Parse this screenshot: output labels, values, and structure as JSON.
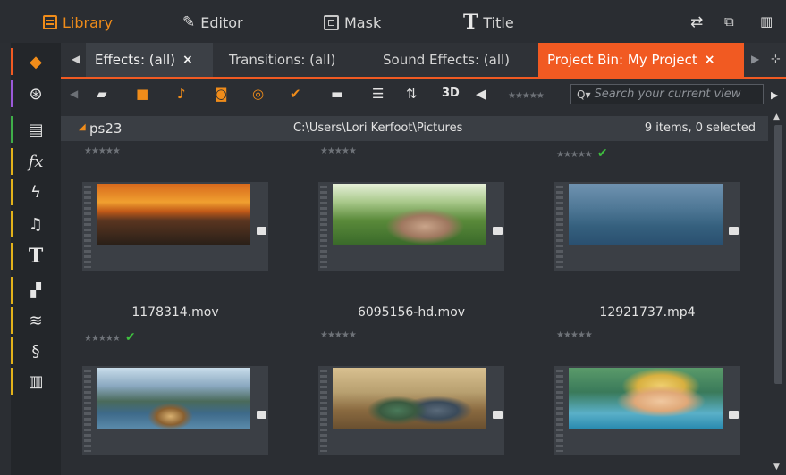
{
  "menu": {
    "library": "Library",
    "editor": "Editor",
    "mask": "Mask",
    "title": "Title",
    "title_glyph": "T",
    "editor_glyph": "✎"
  },
  "tabs": [
    {
      "label": "Effects: (all)",
      "close": "×"
    },
    {
      "label": "Transitions: (all)"
    },
    {
      "label": "Sound Effects: (all)"
    },
    {
      "label": "Project Bin: My Project",
      "close": "×"
    }
  ],
  "toolbar": {
    "label_3d": "3D",
    "search_placeholder": "Search your current view",
    "stars": "★★★★★"
  },
  "sidebar": {
    "fx_label": "fx",
    "title_label": "T"
  },
  "pathbar": {
    "folder": "ps23",
    "path": "C:\\Users\\Lori Kerfoot\\Pictures",
    "count": "9 items, 0 selected"
  },
  "clips": [
    {
      "name": "1178314.mov",
      "rating": "★★★★★",
      "checked": false
    },
    {
      "name": "6095156-hd.mov",
      "rating": "★★★★★",
      "checked": false
    },
    {
      "name": "12921737.mp4",
      "rating": "★★★★★",
      "checked": true
    },
    {
      "name": "",
      "rating": "★★★★★",
      "checked": true
    },
    {
      "name": "",
      "rating": "★★★★★",
      "checked": false
    },
    {
      "name": "",
      "rating": "★★★★★",
      "checked": false
    }
  ],
  "colors": {
    "accent": "#f15a22",
    "library": "#f08c1a",
    "check": "#3fbf3f"
  }
}
